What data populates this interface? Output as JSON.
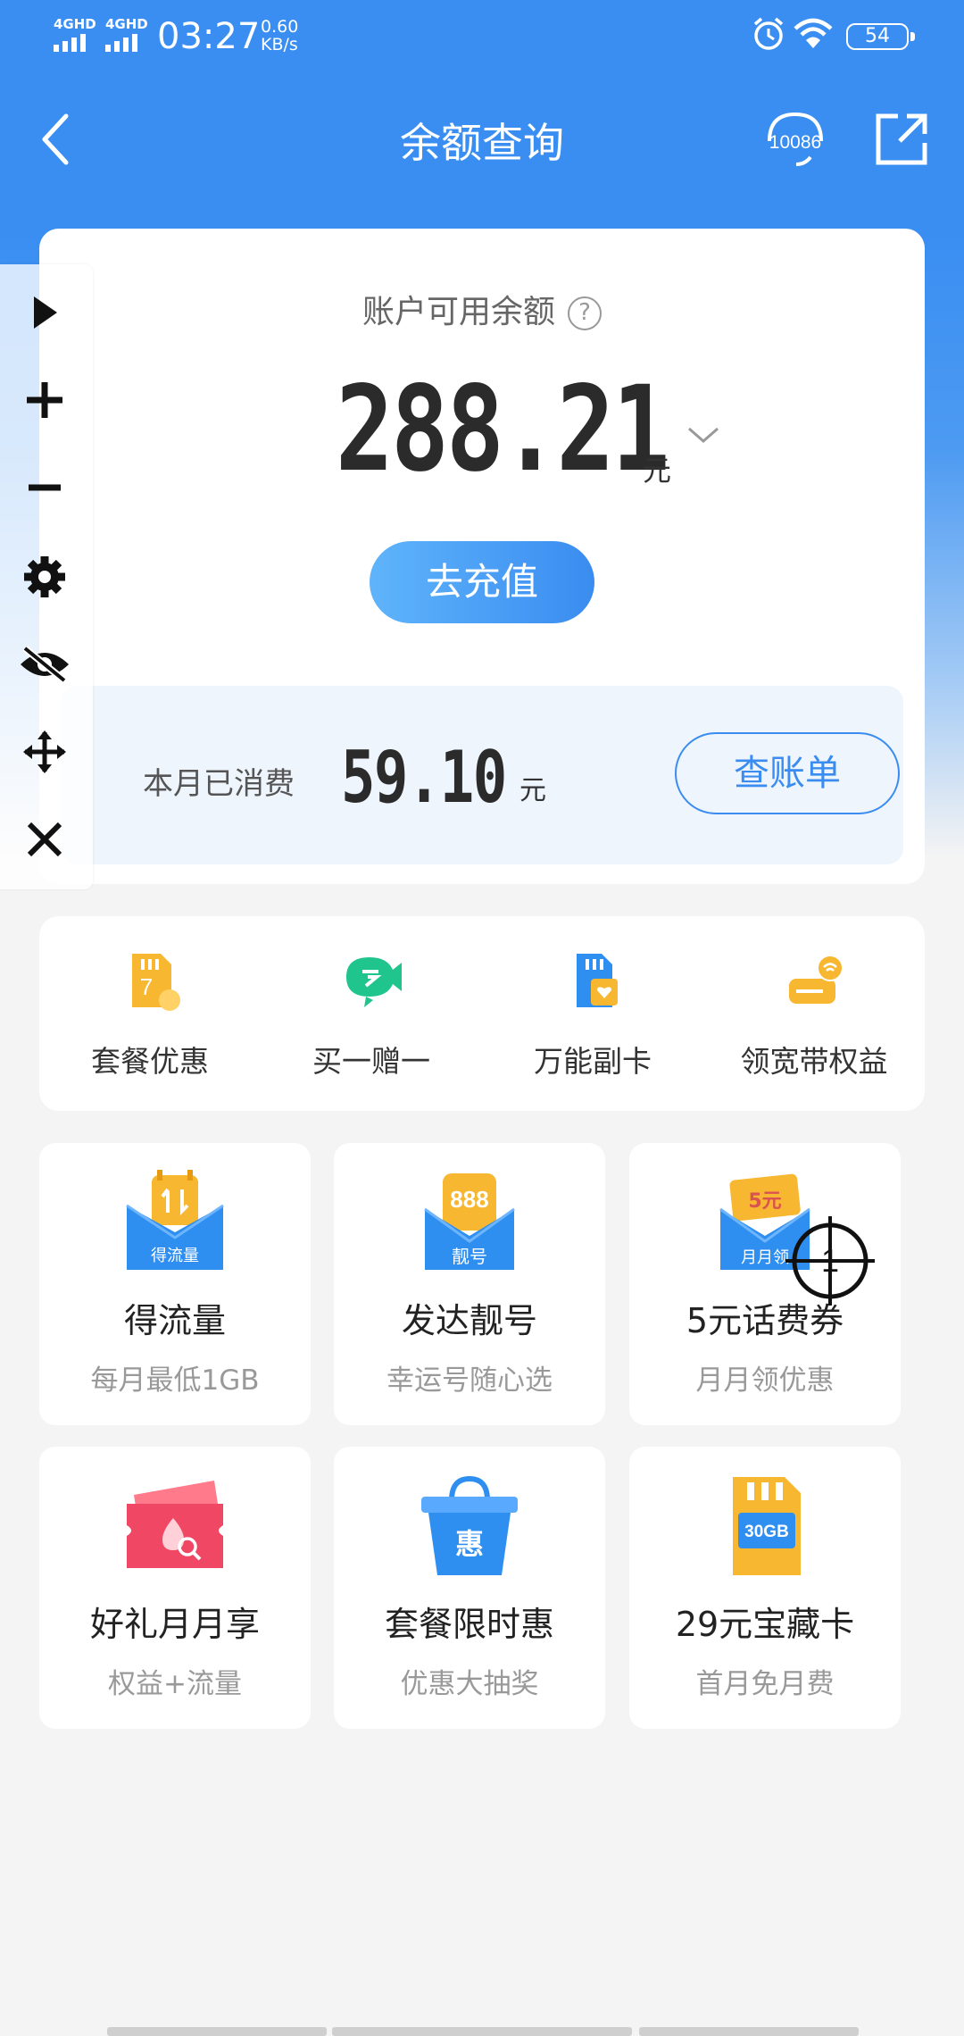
{
  "status_bar": {
    "sig1": "4GHD",
    "sig2": "4GHD",
    "time": "03:27",
    "speed_value": "0.60",
    "speed_unit": "KB/s",
    "battery": "54"
  },
  "header": {
    "title": "余额查询",
    "hotline": "10086"
  },
  "balance": {
    "label": "账户可用余额",
    "help": "?",
    "amount": "288.21",
    "unit": "元",
    "recharge_label": "去充值"
  },
  "monthly": {
    "label": "本月已消费",
    "amount": "59.10",
    "unit": "元",
    "bill_label": "查账单"
  },
  "quick_links": [
    {
      "label": "套餐优惠",
      "icon": "sim-discount-icon",
      "badge": "7"
    },
    {
      "label": "买一赠一",
      "icon": "gift-fish-icon"
    },
    {
      "label": "万能副卡",
      "icon": "sim-heart-icon"
    },
    {
      "label": "领宽带权益",
      "icon": "broadband-router-icon"
    }
  ],
  "tiles": [
    {
      "title": "得流量",
      "subtitle": "每月最低1GB",
      "icon": "data-envelope-icon",
      "icon_text": "得流量"
    },
    {
      "title": "发达靓号",
      "subtitle": "幸运号随心选",
      "icon": "lucky-number-icon",
      "icon_text": "靓号",
      "icon_badge": "888"
    },
    {
      "title": "5元话费券",
      "subtitle": "月月领优惠",
      "icon": "coupon-envelope-icon",
      "icon_text": "月月领",
      "icon_badge": "5元"
    },
    {
      "title": "好礼月月享",
      "subtitle": "权益+流量",
      "icon": "gift-ticket-icon"
    },
    {
      "title": "套餐限时惠",
      "subtitle": "优惠大抽奖",
      "icon": "shopping-basket-icon",
      "icon_text": "惠"
    },
    {
      "title": "29元宝藏卡",
      "subtitle": "首月免月费",
      "icon": "sim-30gb-icon",
      "icon_text": "30GB"
    }
  ],
  "overlay": {
    "crosshair_label": "1"
  },
  "colors": {
    "primary_blue": "#3a8ef2",
    "text_dark": "#222222",
    "text_grey": "#999999"
  }
}
